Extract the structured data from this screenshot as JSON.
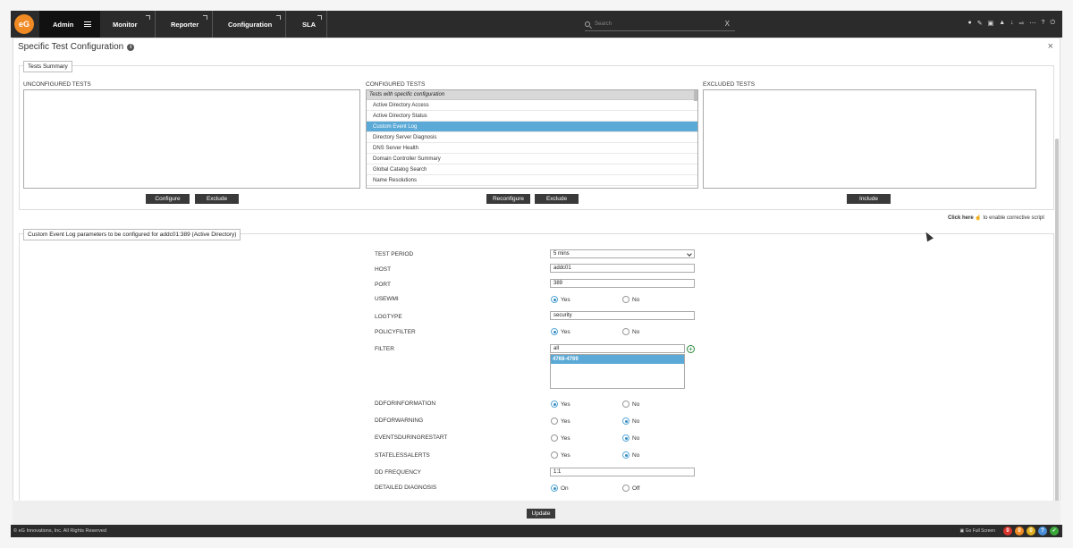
{
  "nav": {
    "logo": "eG",
    "tabs": [
      {
        "label": "Admin"
      },
      {
        "label": "Monitor"
      },
      {
        "label": "Reporter"
      },
      {
        "label": "Configuration"
      },
      {
        "label": "SLA"
      }
    ],
    "search_placeholder": "Search",
    "search_clear": "X",
    "icons": [
      "user-icon",
      "tools-icon",
      "layers-icon",
      "bell-icon",
      "download-icon",
      "logout-icon",
      "more-icon",
      "help-icon",
      "power-icon"
    ]
  },
  "panel": {
    "title": "Specific Test Configuration",
    "close": "×"
  },
  "summary": {
    "legend": "Tests Summary",
    "unconfigured_label": "UNCONFIGURED TESTS",
    "configured_label": "CONFIGURED TESTS",
    "excluded_label": "EXCLUDED TESTS",
    "configured_group": "Tests with specific configuration",
    "configured_items": [
      "Active Directory Access",
      "Active Directory Status",
      "Custom Event Log",
      "Directory Server Diagnosis",
      "DNS Server Health",
      "Domain Controller Summary",
      "Global Catalog Search",
      "Name Resolutions"
    ],
    "selected_item": "Custom Event Log",
    "buttons": {
      "configure": "Configure",
      "exclude1": "Exclude",
      "reconfigure": "Reconfigure",
      "exclude2": "Exclude",
      "include": "Include"
    }
  },
  "corrective": {
    "link": "Click here",
    "text": "to enable corrective script"
  },
  "params": {
    "legend": "Custom Event Log parameters to be configured for addc01:389 (Active Directory)",
    "test_period_label": "TEST PERIOD",
    "test_period_value": "5 mins",
    "host_label": "HOST",
    "host_value": "addc01",
    "port_label": "PORT",
    "port_value": "389",
    "usewmi_label": "USEWMI",
    "logtype_label": "LOGTYPE",
    "logtype_value": "security",
    "policyfilter_label": "POLICYFILTER",
    "filter_label": "FILTER",
    "filter_value": "all",
    "filter_item": "4768-4769",
    "ddforinformation_label": "DDFORINFORMATION",
    "ddforwarning_label": "DDFORWARNING",
    "eventsduringrestart_label": "EVENTSDURINGRESTART",
    "statelessalerts_label": "STATELESSALERTS",
    "ddfrequency_label": "DD FREQUENCY",
    "ddfrequency_value": "1:1",
    "detailed_label": "DETAILED DIAGNOSIS",
    "yes": "Yes",
    "no": "No",
    "on": "On",
    "off": "Off",
    "update": "Update"
  },
  "footer": {
    "copyright": "© eG Innovations, Inc. All Rights Reserved",
    "fullscreen": "Go Full Screen",
    "status_counts": [
      "0",
      "0",
      "0",
      "0"
    ],
    "colors": [
      "#d9342b",
      "#f08a24",
      "#e0b020",
      "#4a90d9",
      "#3aa83a"
    ]
  }
}
